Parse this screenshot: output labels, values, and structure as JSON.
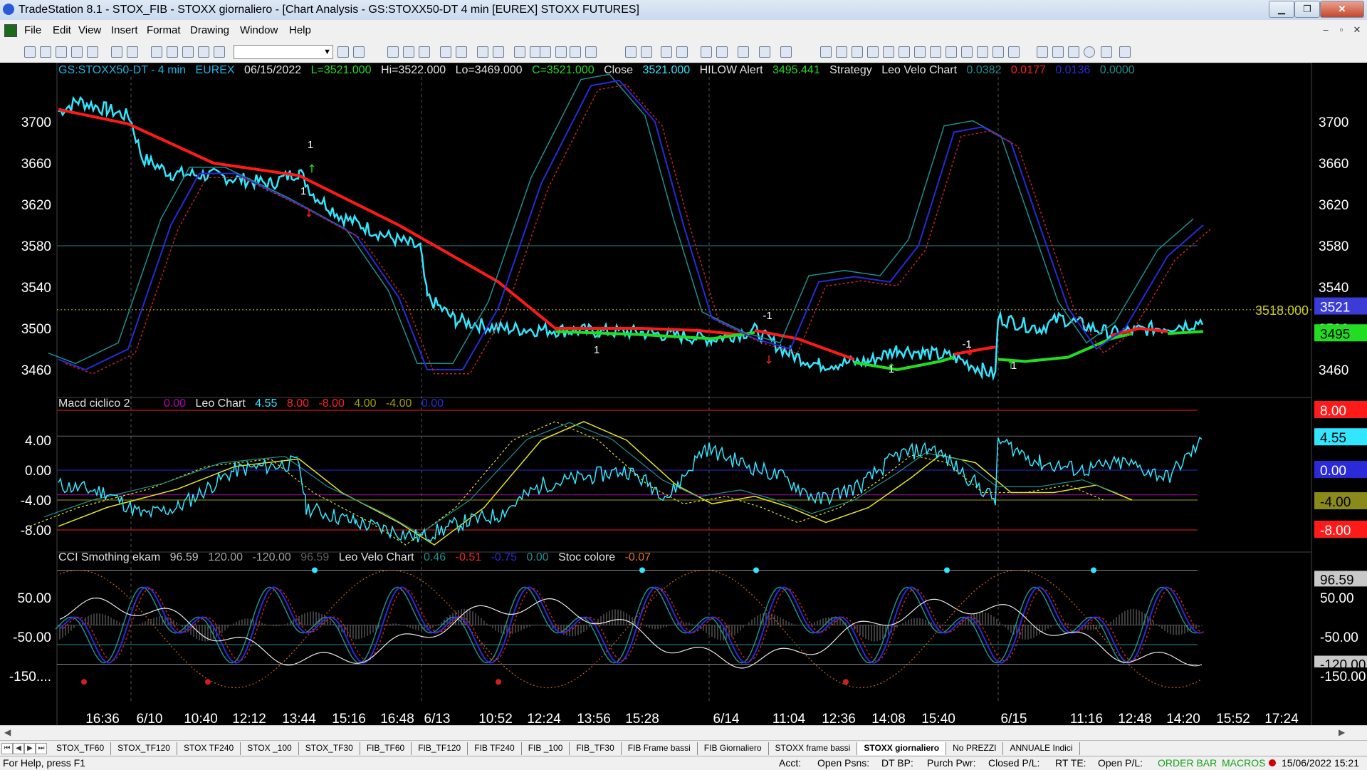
{
  "window": {
    "title": "TradeStation 8.1 - STOX_FIB - STOXX giornaliero - [Chart Analysis - GS:STOXX50-DT  4 min  [EUREX] STOXX FUTURES]",
    "minimize_label": "▁",
    "restore_label": "❐",
    "close_label": "✕"
  },
  "menu": {
    "items": [
      "File",
      "Edit",
      "View",
      "Insert",
      "Format",
      "Drawing",
      "Window",
      "Help"
    ],
    "mdi_minimize": "–",
    "mdi_restore": "▫",
    "mdi_close": "✕"
  },
  "toolbar": {
    "combo_value": ""
  },
  "chart": {
    "header": {
      "symbol": "GS:STOXX50-DT - 4 min",
      "exchange": "EUREX",
      "date": "06/15/2022",
      "last": "L=3521.000",
      "high": "Hi=3522.000",
      "low": "Lo=3469.000",
      "close": "C=3521.000",
      "close_label": "Close",
      "close_value": "3521.000",
      "hilow_label": "HILOW Alert",
      "hilow_value": "3495.441",
      "strategy": "Strategy",
      "leo_velo": "Leo Velo Chart",
      "v1": "0.0382",
      "v2": "0.0177",
      "v3": "0.0136",
      "v4": "0.0000"
    },
    "price_axis": [
      "3700",
      "3660",
      "3620",
      "3580",
      "3540",
      "3500",
      "3460"
    ],
    "level_label": "3518.000",
    "last_price_tag": "3521",
    "hilow_tag": "3495",
    "markers": [
      "1",
      "1",
      "-1",
      "1",
      "-1",
      "1",
      "1"
    ],
    "macd": {
      "title": "Macd ciclico 2",
      "v0": "0.00",
      "leo": "Leo Chart",
      "v1": "4.55",
      "v2": "8.00",
      "v3": "-8.00",
      "v4": "4.00",
      "v5": "-4.00",
      "v6": "0.00",
      "axis": [
        "4.00",
        "0.00",
        "-4.00",
        "-8.00"
      ],
      "tags": [
        "8.00",
        "4.55",
        "0.00",
        "-4.00",
        "-8.00"
      ]
    },
    "cci": {
      "title": "CCI Smothing ekam",
      "v1": "96.59",
      "v2": "120.00",
      "v3": "-120.00",
      "v4": "96.59",
      "leo": "Leo Velo Chart",
      "v5": "0.46",
      "v6": "-0.51",
      "v7": "-0.75",
      "v8": "0.00",
      "stoc": "Stoc colore",
      "v9": "-0.07",
      "axis": [
        "50.00",
        "-50.00",
        "-150...."
      ],
      "tags": [
        "96.59",
        "50.00",
        "-50.00",
        "-120.00",
        "-150.00"
      ]
    },
    "time_axis": [
      "16:36",
      "6/10",
      "10:40",
      "12:12",
      "13:44",
      "15:16",
      "16:48",
      "6/13",
      "10:52",
      "12:24",
      "13:56",
      "15:28",
      "6/14",
      "11:04",
      "12:36",
      "14:08",
      "15:40",
      "6/15",
      "11:16",
      "12:48",
      "14:20",
      "15:52",
      "17:24"
    ],
    "colors": {
      "price": "#33e6ff",
      "avg_red": "#ff1a1a",
      "avg_green": "#22dd22",
      "blue": "#2a2ad8",
      "red_dot": "#d02020",
      "teal": "#1f8f8f",
      "yellow": "#e6e61a",
      "level": "#c8c820",
      "grid": "#2f7f7f"
    }
  },
  "tabs": [
    "STOX_TF60",
    "STOX_TF120",
    "STOX TF240",
    "STOX _100",
    "STOX_TF30",
    "FIB_TF60",
    "FIB_TF120",
    "FIB TF240",
    "FIB _100",
    "FIB_TF30",
    "FIB Frame bassi",
    "FIB Giornaliero",
    "STOXX frame bassi",
    "STOXX giornaliero",
    "No PREZZI",
    "ANNUALE Indici"
  ],
  "active_tab": "STOXX giornaliero",
  "status": {
    "help": "For Help, press F1",
    "acct": "Acct:",
    "open_psns": "Open Psns:",
    "dt_bp": "DT BP:",
    "purch_pwr": "Purch Pwr:",
    "closed_pl": "Closed P/L:",
    "rt_te": "RT TE:",
    "open_pl": "Open P/L:",
    "order_bar": "ORDER BAR",
    "macros": "MACROS",
    "datetime": "15/06/2022 15:21"
  }
}
